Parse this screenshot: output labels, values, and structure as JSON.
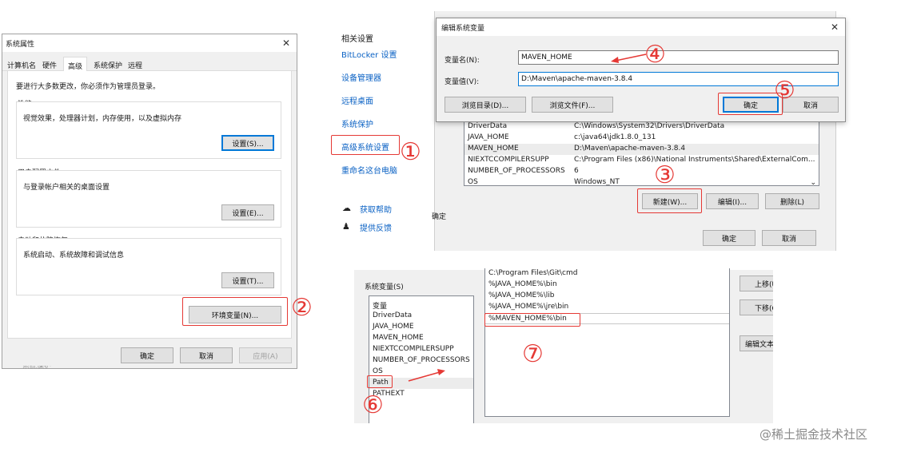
{
  "sysprops": {
    "title": "系统属性",
    "tabs": [
      "计算机名",
      "硬件",
      "高级",
      "系统保护",
      "远程"
    ],
    "admin_note": "要进行大多数更改，你必须作为管理员登录。",
    "perf": {
      "label": "性能",
      "desc": "视觉效果，处理器计划，内存使用，以及虚拟内存",
      "btn": "设置(S)..."
    },
    "profile": {
      "label": "用户配置文件",
      "desc": "与登录帐户相关的桌面设置",
      "btn": "设置(E)..."
    },
    "startup": {
      "label": "启动和故障恢复",
      "desc": "系统启动、系统故障和调试信息",
      "btn": "设置(T)..."
    },
    "env_btn": "环境变量(N)...",
    "ok": "确定",
    "cancel": "取消",
    "apply": "应用(A)",
    "bottom_fragment": "系统保护"
  },
  "related": {
    "heading": "相关设置",
    "links": [
      "BitLocker 设置",
      "设备管理器",
      "远程桌面",
      "系统保护",
      "高级系统设置",
      "重命名这台电脑"
    ],
    "help": "获取帮助",
    "feedback": "提供反馈",
    "partial_btn": "确定"
  },
  "editvar": {
    "title": "编辑系统变量",
    "name_label": "变量名(N):",
    "name_value": "MAVEN_HOME",
    "value_label": "变量值(V):",
    "value_value": "D:\\Maven\\apache-maven-3.8.4",
    "browse_dir": "浏览目录(D)...",
    "browse_file": "浏览文件(F)...",
    "ok": "确定",
    "cancel": "取消"
  },
  "sysvars": {
    "rows": [
      {
        "name": "DriverData",
        "value": "C:\\Windows\\System32\\Drivers\\DriverData"
      },
      {
        "name": "JAVA_HOME",
        "value": "c:\\java64\\jdk1.8.0_131"
      },
      {
        "name": "MAVEN_HOME",
        "value": "D:\\Maven\\apache-maven-3.8.4"
      },
      {
        "name": "NIEXTCCOMPILERSUPP",
        "value": "C:\\Program Files (x86)\\National Instruments\\Shared\\ExternalCom..."
      },
      {
        "name": "NUMBER_OF_PROCESSORS",
        "value": "6"
      },
      {
        "name": "OS",
        "value": "Windows_NT"
      }
    ],
    "new_btn": "新建(W)...",
    "edit_btn": "编辑(I)...",
    "delete_btn": "删除(L)",
    "ok": "确定",
    "cancel": "取消"
  },
  "path_panel": {
    "label": "系统变量(S)",
    "vars": [
      "变量",
      "DriverData",
      "JAVA_HOME",
      "MAVEN_HOME",
      "NIEXTCCOMPILERSUPP",
      "NUMBER_OF_PROCESSORS",
      "OS",
      "Path",
      "PATHEXT"
    ],
    "entries": [
      "C:\\Program Files\\Git\\cmd",
      "%JAVA_HOME%\\bin",
      "%JAVA_HOME%\\lib",
      "%JAVA_HOME%\\jre\\bin",
      "%MAVEN_HOME%\\bin"
    ],
    "move_up": "上移(U)",
    "move_down": "下移(O)",
    "edit_text": "编辑文本"
  },
  "steps": [
    "①",
    "②",
    "③",
    "④",
    "⑤",
    "⑥",
    "⑦"
  ],
  "watermark": "@稀土掘金技术社区",
  "colors": {
    "annotation_red": "#e53935",
    "link_blue": "#0b62c4",
    "focus_blue": "#0078d7"
  }
}
